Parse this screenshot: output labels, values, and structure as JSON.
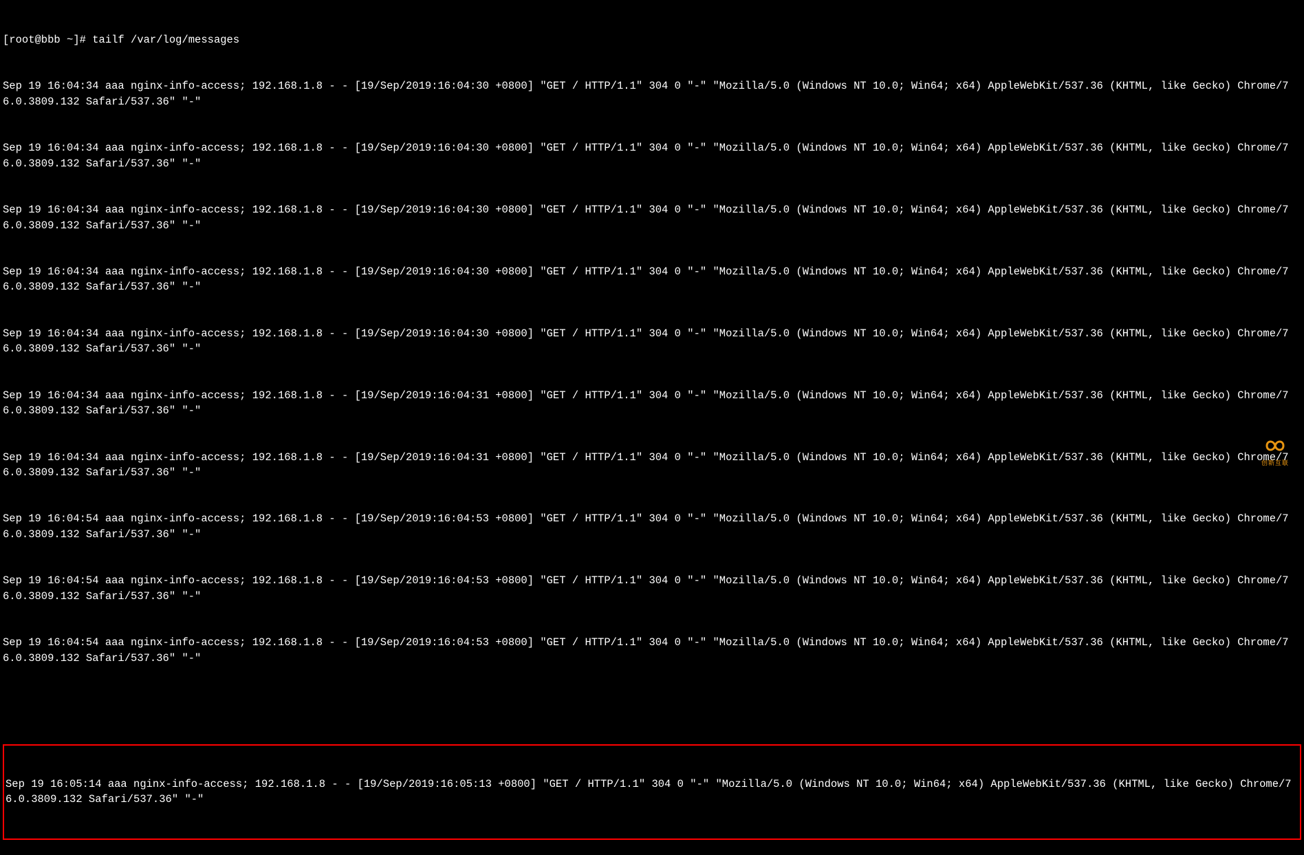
{
  "prompt": "[root@bbb ~]# tailf /var/log/messages",
  "log_lines": [
    "Sep 19 16:04:34 aaa nginx-info-access; 192.168.1.8 - - [19/Sep/2019:16:04:30 +0800] \"GET / HTTP/1.1\" 304 0 \"-\" \"Mozilla/5.0 (Windows NT 10.0; Win64; x64) AppleWebKit/537.36 (KHTML, like Gecko) Chrome/76.0.3809.132 Safari/537.36\" \"-\"",
    "Sep 19 16:04:34 aaa nginx-info-access; 192.168.1.8 - - [19/Sep/2019:16:04:30 +0800] \"GET / HTTP/1.1\" 304 0 \"-\" \"Mozilla/5.0 (Windows NT 10.0; Win64; x64) AppleWebKit/537.36 (KHTML, like Gecko) Chrome/76.0.3809.132 Safari/537.36\" \"-\"",
    "Sep 19 16:04:34 aaa nginx-info-access; 192.168.1.8 - - [19/Sep/2019:16:04:30 +0800] \"GET / HTTP/1.1\" 304 0 \"-\" \"Mozilla/5.0 (Windows NT 10.0; Win64; x64) AppleWebKit/537.36 (KHTML, like Gecko) Chrome/76.0.3809.132 Safari/537.36\" \"-\"",
    "Sep 19 16:04:34 aaa nginx-info-access; 192.168.1.8 - - [19/Sep/2019:16:04:30 +0800] \"GET / HTTP/1.1\" 304 0 \"-\" \"Mozilla/5.0 (Windows NT 10.0; Win64; x64) AppleWebKit/537.36 (KHTML, like Gecko) Chrome/76.0.3809.132 Safari/537.36\" \"-\"",
    "Sep 19 16:04:34 aaa nginx-info-access; 192.168.1.8 - - [19/Sep/2019:16:04:30 +0800] \"GET / HTTP/1.1\" 304 0 \"-\" \"Mozilla/5.0 (Windows NT 10.0; Win64; x64) AppleWebKit/537.36 (KHTML, like Gecko) Chrome/76.0.3809.132 Safari/537.36\" \"-\"",
    "Sep 19 16:04:34 aaa nginx-info-access; 192.168.1.8 - - [19/Sep/2019:16:04:31 +0800] \"GET / HTTP/1.1\" 304 0 \"-\" \"Mozilla/5.0 (Windows NT 10.0; Win64; x64) AppleWebKit/537.36 (KHTML, like Gecko) Chrome/76.0.3809.132 Safari/537.36\" \"-\"",
    "Sep 19 16:04:34 aaa nginx-info-access; 192.168.1.8 - - [19/Sep/2019:16:04:31 +0800] \"GET / HTTP/1.1\" 304 0 \"-\" \"Mozilla/5.0 (Windows NT 10.0; Win64; x64) AppleWebKit/537.36 (KHTML, like Gecko) Chrome/76.0.3809.132 Safari/537.36\" \"-\"",
    "Sep 19 16:04:54 aaa nginx-info-access; 192.168.1.8 - - [19/Sep/2019:16:04:53 +0800] \"GET / HTTP/1.1\" 304 0 \"-\" \"Mozilla/5.0 (Windows NT 10.0; Win64; x64) AppleWebKit/537.36 (KHTML, like Gecko) Chrome/76.0.3809.132 Safari/537.36\" \"-\"",
    "Sep 19 16:04:54 aaa nginx-info-access; 192.168.1.8 - - [19/Sep/2019:16:04:53 +0800] \"GET / HTTP/1.1\" 304 0 \"-\" \"Mozilla/5.0 (Windows NT 10.0; Win64; x64) AppleWebKit/537.36 (KHTML, like Gecko) Chrome/76.0.3809.132 Safari/537.36\" \"-\"",
    "Sep 19 16:04:54 aaa nginx-info-access; 192.168.1.8 - - [19/Sep/2019:16:04:53 +0800] \"GET / HTTP/1.1\" 304 0 \"-\" \"Mozilla/5.0 (Windows NT 10.0; Win64; x64) AppleWebKit/537.36 (KHTML, like Gecko) Chrome/76.0.3809.132 Safari/537.36\" \"-\""
  ],
  "highlighted_line": "Sep 19 16:05:14 aaa nginx-info-access; 192.168.1.8 - - [19/Sep/2019:16:05:13 +0800] \"GET / HTTP/1.1\" 304 0 \"-\" \"Mozilla/5.0 (Windows NT 10.0; Win64; x64) AppleWebKit/537.36 (KHTML, like Gecko) Chrome/76.0.3809.132 Safari/537.36\" \"-\"",
  "watermark": {
    "text": "创新互联"
  }
}
